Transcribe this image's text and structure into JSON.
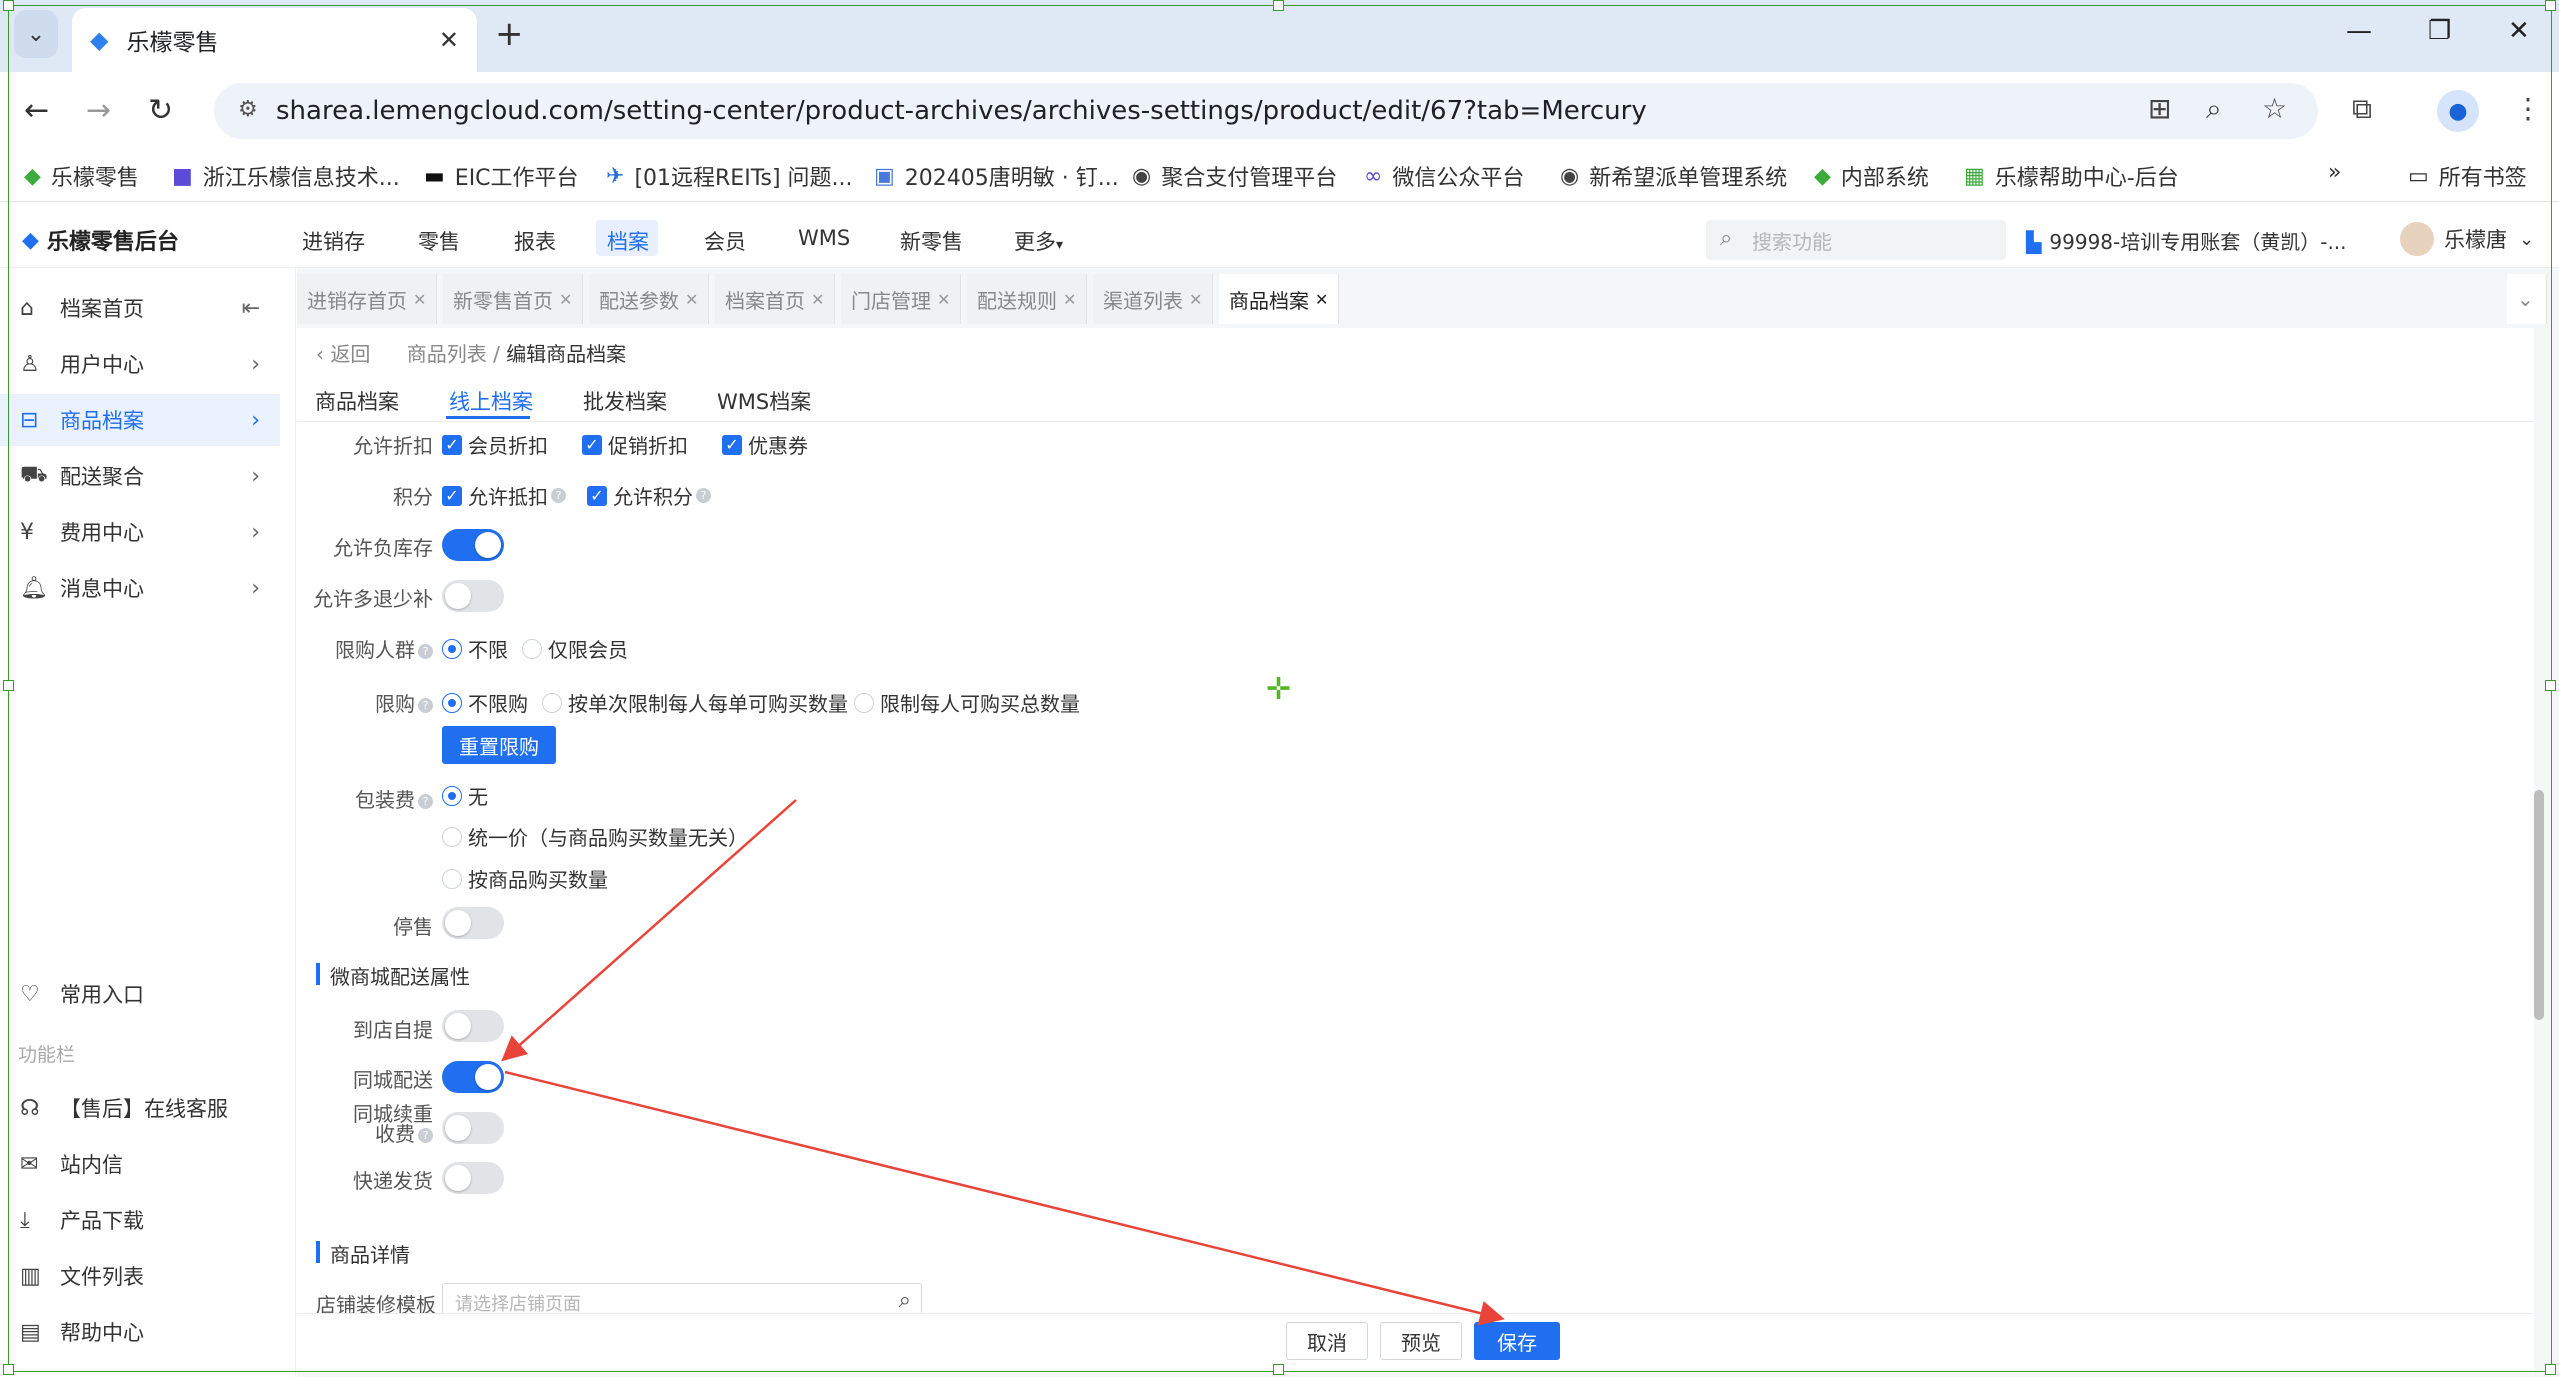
{
  "browser": {
    "tab_title": "乐檬零售",
    "url": "sharea.lemengcloud.com/setting-center/product-archives/archives-settings/product/edit/67?tab=Mercury",
    "bookmarks": [
      "乐檬零售",
      "浙江乐檬信息技术...",
      "EIC工作平台",
      "[01远程REITs] 问题...",
      "202405唐明敏 · 钉...",
      "聚合支付管理平台",
      "微信公众平台",
      "新希望派单管理系统",
      "内部系统",
      "乐檬帮助中心-后台"
    ],
    "all_bookmarks": "所有书签"
  },
  "app": {
    "logo": "乐檬零售后台",
    "top_nav": [
      "进销存",
      "零售",
      "报表",
      "档案",
      "会员",
      "WMS",
      "新零售",
      "更多"
    ],
    "search_placeholder": "搜索功能",
    "account": "99998-培训专用账套（黄凯）-...",
    "user": "乐檬唐"
  },
  "sidebar": {
    "items": [
      {
        "label": "档案首页",
        "icon": "home-icon"
      },
      {
        "label": "用户中心",
        "icon": "user-icon"
      },
      {
        "label": "商品档案",
        "icon": "box-icon"
      },
      {
        "label": "配送聚合",
        "icon": "truck-icon"
      },
      {
        "label": "费用中心",
        "icon": "money-icon"
      },
      {
        "label": "消息中心",
        "icon": "bell-icon"
      }
    ],
    "common_entry": "常用入口",
    "section_label": "功能栏",
    "tools": [
      "【售后】在线客服",
      "站内信",
      "产品下载",
      "文件列表",
      "帮助中心"
    ]
  },
  "page_tabs": [
    "进销存首页",
    "新零售首页",
    "配送参数",
    "档案首页",
    "门店管理",
    "配送规则",
    "渠道列表",
    "商品档案"
  ],
  "breadcrumb": {
    "back": "返回",
    "parent": "商品列表",
    "current": "编辑商品档案"
  },
  "sub_tabs": [
    "商品档案",
    "线上档案",
    "批发档案",
    "WMS档案"
  ],
  "form": {
    "allow_discount": {
      "label": "允许折扣",
      "options": [
        "会员折扣",
        "促销折扣",
        "优惠券"
      ]
    },
    "points": {
      "label": "积分",
      "options": [
        "允许抵扣",
        "允许积分"
      ]
    },
    "allow_negative_stock": {
      "label": "允许负库存",
      "on": true
    },
    "allow_refund_diff": {
      "label": "允许多退少补",
      "on": false
    },
    "limit_group": {
      "label": "限购人群",
      "options": [
        "不限",
        "仅限会员"
      ],
      "selected": 0
    },
    "limit_purchase": {
      "label": "限购",
      "options": [
        "不限购",
        "按单次限制每人每单可购买数量",
        "限制每人可购买总数量"
      ],
      "selected": 0,
      "reset_button": "重置限购"
    },
    "packaging_fee": {
      "label": "包装费",
      "options": [
        "无",
        "统一价（与商品购买数量无关）",
        "按商品购买数量"
      ],
      "selected": 0
    },
    "suspend_sale": {
      "label": "停售",
      "on": false
    },
    "delivery_section": "微商城配送属性",
    "store_pickup": {
      "label": "到店自提",
      "on": false
    },
    "same_city": {
      "label": "同城配送",
      "on": true
    },
    "same_city_weight": {
      "label_line1": "同城续重",
      "label_line2": "收费",
      "on": false
    },
    "express": {
      "label": "快递发货",
      "on": false
    },
    "details_section": "商品详情",
    "store_template": {
      "label": "店铺装修模板",
      "placeholder": "请选择店铺页面"
    }
  },
  "footer": {
    "cancel": "取消",
    "preview": "预览",
    "save": "保存"
  },
  "colors": {
    "primary": "#1f6ff0",
    "annotation_arrow": "#e8443a"
  }
}
